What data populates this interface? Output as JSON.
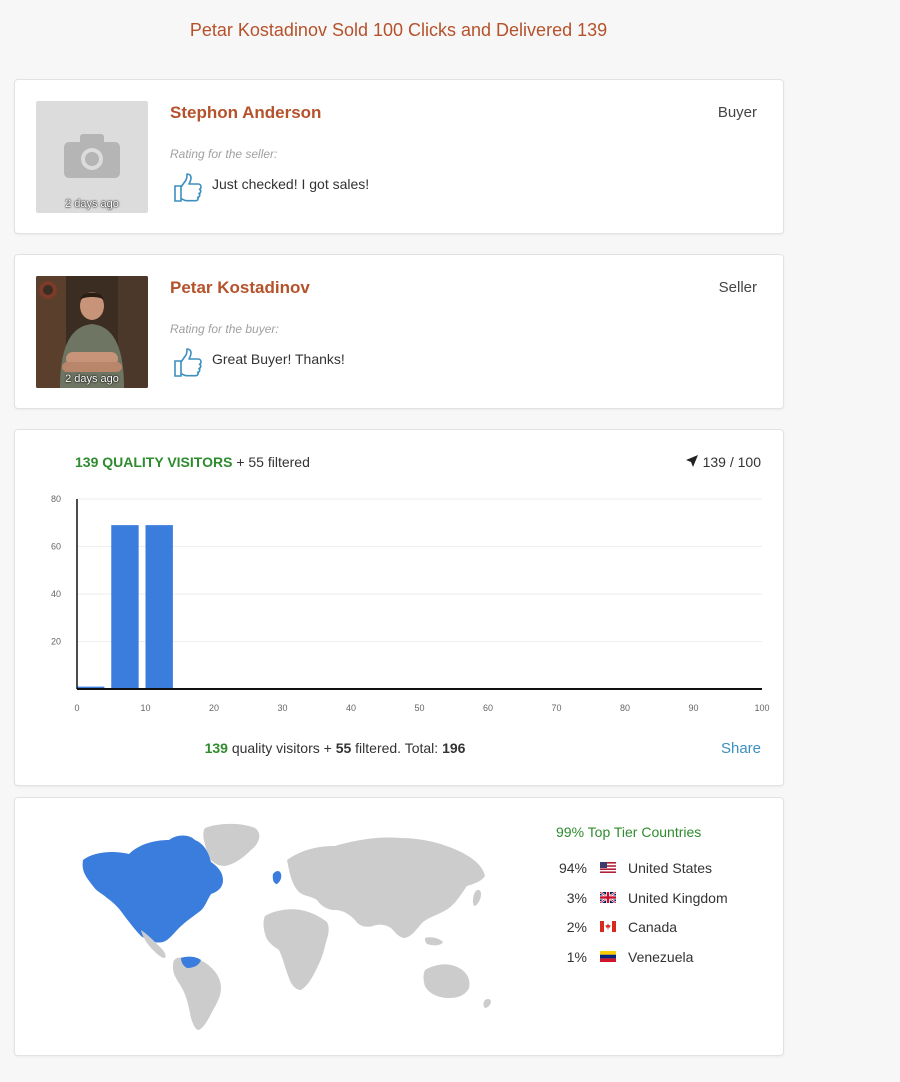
{
  "page": {
    "title": "Petar Kostadinov Sold 100 Clicks and Delivered 139"
  },
  "buyer_review": {
    "name": "Stephon Anderson",
    "role": "Buyer",
    "rating_label": "Rating for the seller:",
    "text": "Just checked! I got sales!",
    "time": "2 days ago",
    "avatar_icon": "camera-icon",
    "rating_icon": "thumbs-up-icon"
  },
  "seller_review": {
    "name": "Petar Kostadinov",
    "role": "Seller",
    "rating_label": "Rating for the buyer:",
    "text": "Great Buyer! Thanks!",
    "time": "2 days ago",
    "rating_icon": "thumbs-up-icon"
  },
  "stats": {
    "heading_quality": "139 QUALITY VISITORS",
    "heading_filtered": "+ 55 filtered",
    "ratio": "139 / 100",
    "ratio_icon": "navigation-arrow-icon",
    "summary_quality": "139",
    "summary_quality_text": "quality visitors +",
    "summary_filtered": "55",
    "summary_filtered_text": "filtered. Total:",
    "summary_total": "196",
    "share_label": "Share"
  },
  "chart_data": {
    "type": "bar",
    "x": [
      0,
      5,
      10
    ],
    "values": [
      1,
      69,
      69
    ],
    "bar_width": 4,
    "xlim": [
      0,
      100
    ],
    "ylim": [
      0,
      80
    ],
    "xticks": [
      0,
      10,
      20,
      30,
      40,
      50,
      60,
      70,
      80,
      90,
      100
    ],
    "yticks": [
      20,
      40,
      60,
      80
    ],
    "bar_color": "#3b7ddd",
    "grid": true
  },
  "geo": {
    "heading": "99% Top Tier Countries",
    "highlight_color": "#3b7ddd",
    "base_color": "#cccccc",
    "countries": [
      {
        "pct": "94%",
        "name": "United States",
        "flag": "us-flag-icon"
      },
      {
        "pct": "3%",
        "name": "United Kingdom",
        "flag": "uk-flag-icon"
      },
      {
        "pct": "2%",
        "name": "Canada",
        "flag": "canada-flag-icon"
      },
      {
        "pct": "1%",
        "name": "Venezuela",
        "flag": "venezuela-flag-icon"
      }
    ]
  }
}
